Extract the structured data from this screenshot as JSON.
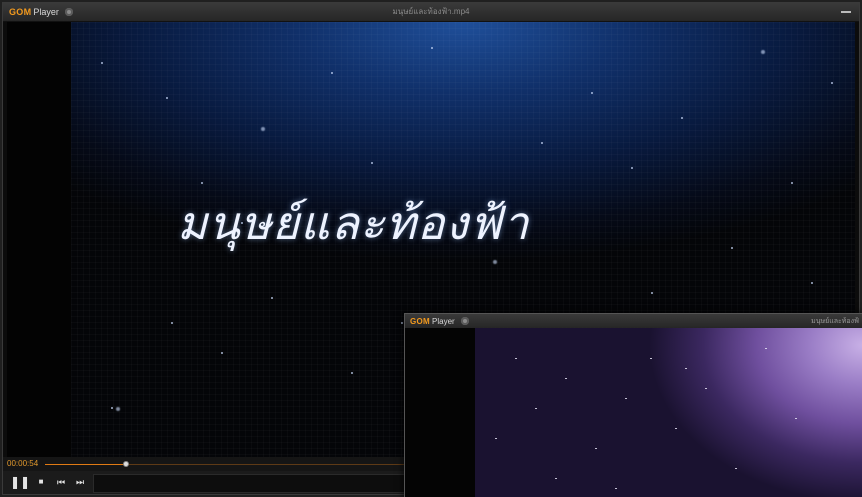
{
  "main_player": {
    "brand": "GOM",
    "brand_suffix": "Player",
    "file_title": "มนุษย์และท้องฟ้า.mp4",
    "video_title": "มนุษย์และท้องฟ้า",
    "current_time": "00:00:54",
    "progress": 0.1,
    "controls": {
      "pause_icon": "pause-icon",
      "stop_icon": "stop-icon",
      "prev_icon": "previous-icon",
      "next_icon": "next-icon"
    }
  },
  "second_player": {
    "brand": "GOM",
    "brand_suffix": "Player",
    "file_title": "มนุษย์และท้องฟ้"
  },
  "colors": {
    "accent": "#f39a1e",
    "titlebar": "#2e2e2e"
  }
}
